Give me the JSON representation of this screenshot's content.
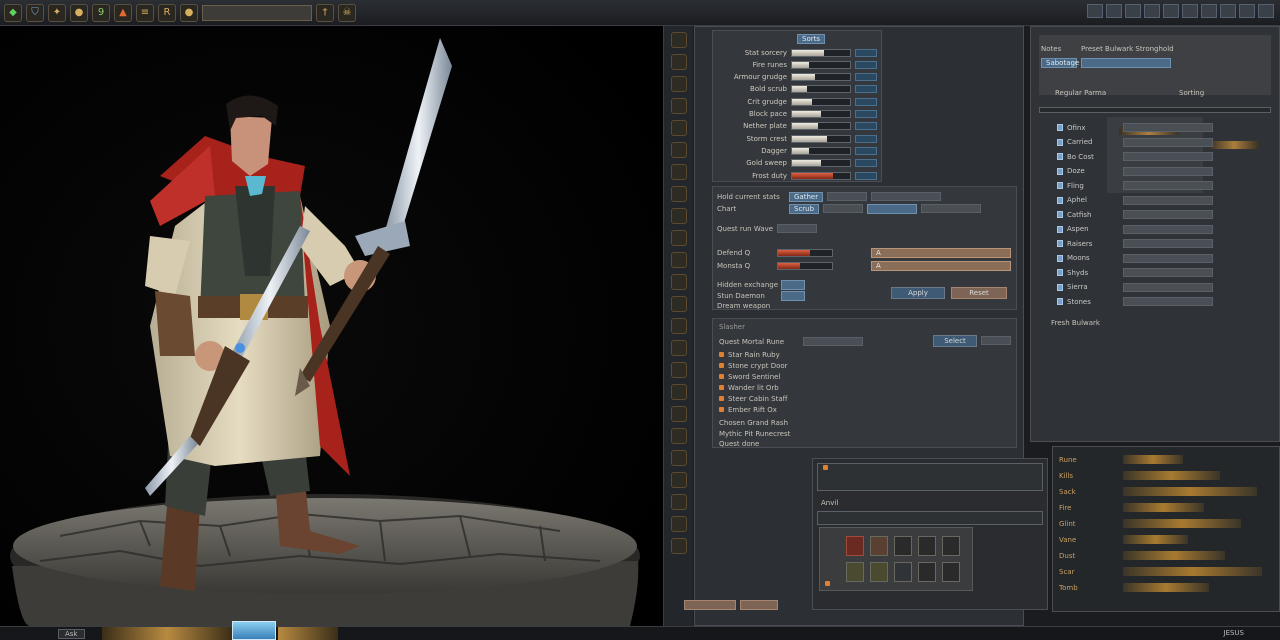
{
  "app": {
    "status_right": "JESUS"
  },
  "toolbar": {
    "icons": [
      "emerald-gem-icon",
      "shield-icon",
      "rune-icon",
      "coin-icon",
      "flame-icon",
      "scroll-icon",
      "sword-icon",
      "skull-icon"
    ],
    "number_icon_text": "9",
    "letter_icon_text": "R"
  },
  "stats_panel": {
    "rows": [
      {
        "label": "Stat sorcery",
        "fill": 0.55,
        "style": "light"
      },
      {
        "label": "Fire runes",
        "fill": 0.3,
        "style": "light"
      },
      {
        "label": "Armour grudge",
        "fill": 0.4,
        "style": "light"
      },
      {
        "label": "Bold scrub",
        "fill": 0.25,
        "style": "light"
      },
      {
        "label": "Crit grudge",
        "fill": 0.35,
        "style": "light"
      },
      {
        "label": "Block pace",
        "fill": 0.5,
        "style": "light"
      },
      {
        "label": "Nether plate",
        "fill": 0.45,
        "style": "light"
      },
      {
        "label": "Storm crest",
        "fill": 0.6,
        "style": "light"
      },
      {
        "label": "Dagger",
        "fill": 0.3,
        "style": "light"
      },
      {
        "label": "Gold sweep",
        "fill": 0.5,
        "style": "light"
      },
      {
        "label": "Frost duty",
        "fill": 0.7,
        "style": "red"
      }
    ],
    "header_chip": "Sorts"
  },
  "equip_panel": {
    "row1_label": "Hold current stats",
    "row1_chip": "Gather",
    "row2_label": "Chart",
    "row2_chip": "Scrub",
    "section_label": "Quest run Wave",
    "hp_label": "Defend Q",
    "mp_label": "Monsta Q",
    "hp_chip": "A",
    "mp_chip": "A",
    "opt1": "Hidden exchange",
    "opt2": "Stun Daemon",
    "opt3": "Dream weapon",
    "btn_ok": "Apply",
    "btn_cancel": "Reset"
  },
  "quest_panel": {
    "header": "Slasher",
    "title": "Quest Mortal Rune",
    "button": "Select",
    "items": [
      "Star Rain Ruby",
      "Stone crypt Door",
      "Sword Sentinel",
      "Wander lit Orb",
      "Steer Cabin Staff",
      "Ember Rift Ox"
    ],
    "footer1": "Chosen Grand Rash",
    "footer2": "Mythic Pit Runecrest",
    "footer3": "Quest done"
  },
  "inventory_panel": {
    "label": "Anvil"
  },
  "right_panel": {
    "header": "Preset Bulwark Stronghold",
    "sub1": "Notes",
    "sub2": "Sabotage",
    "sub3": "Regular Parma",
    "sub4": "Sorting",
    "items": [
      "Ofinx",
      "Carried",
      "Bo Cost",
      "Doze",
      "Fling",
      "Aphel",
      "Catfish",
      "Aspen",
      "Raisers",
      "Moons",
      "Shyds",
      "Sierra",
      "Stones"
    ],
    "footer": "Fresh Bulwark"
  },
  "log_panel": {
    "lines": [
      "Rune",
      "Kills",
      "Sack",
      "Fire",
      "Glint",
      "Vane",
      "Dust",
      "Scar",
      "Tomb"
    ]
  },
  "bottom": {
    "left": "Ask"
  }
}
